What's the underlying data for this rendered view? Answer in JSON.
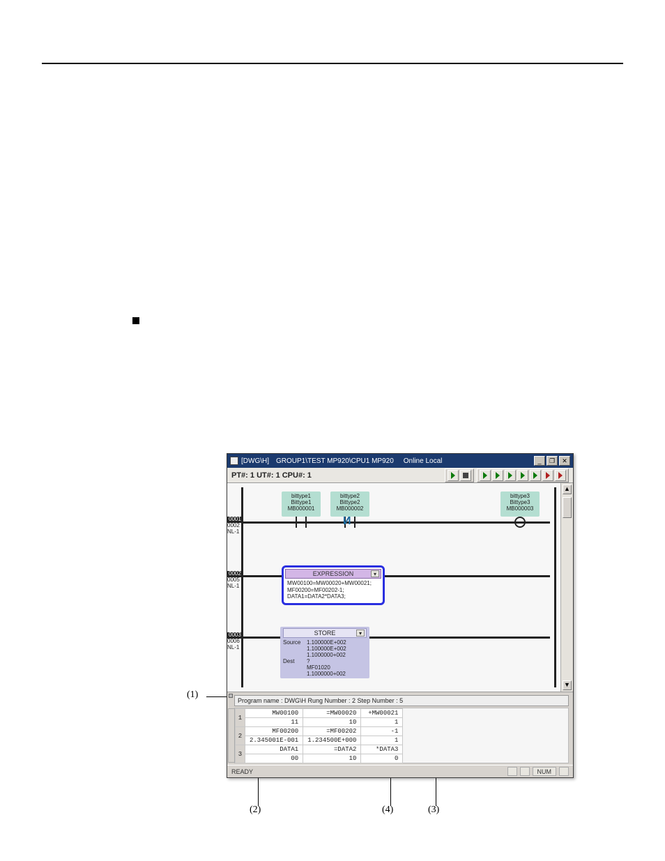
{
  "window": {
    "title_left": "[DWG\\H]",
    "title_path": "GROUP1\\TEST MP920\\CPU1 MP920",
    "title_mode": "Online Local",
    "min": "_",
    "restore": "❐",
    "close": "✕"
  },
  "subheader": {
    "text": "PT#: 1 UT#: 1 CPU#: 1"
  },
  "rungs": {
    "r1": {
      "num": "0001",
      "addr": "0002",
      "nl": "NL-1"
    },
    "r2": {
      "num": "0002",
      "addr": "0005",
      "nl": "NL-1"
    },
    "r3": {
      "num": "0003",
      "addr": "0006",
      "nl": "NL-1"
    }
  },
  "blocks": {
    "b1": {
      "l1": "bittype1",
      "l2": "Bittype1",
      "l3": "MB000001"
    },
    "b2": {
      "l1": "bittype2",
      "l2": "Bittype2",
      "l3": "MB000002"
    },
    "b3": {
      "l1": "bittype3",
      "l2": "Bittype3",
      "l3": "MB000003"
    }
  },
  "expression": {
    "title": "EXPRESSION",
    "line1": "MW00100=MW00020+MW00021;",
    "line2": "MF00200=MF00202-1;",
    "line3": "DATA1=DATA2*DATA3;"
  },
  "store": {
    "title": "STORE",
    "src_lbl": "Source",
    "src1": "1.100000E+002",
    "src2": "1.100000E+002",
    "src3": "1.1000000+002",
    "dst_lbl": "Dest",
    "dst1": "?",
    "dst2": "MF01020",
    "dst3": "1.1000000+002"
  },
  "panel": {
    "header": "Program name : DWG\\H Rung Number : 2 Step Number : 5"
  },
  "grid": {
    "r1": {
      "idx": "1",
      "c1": "MW00100",
      "c2": "=MW00020",
      "c3": "+MW00021"
    },
    "r1b": {
      "c1": "11",
      "c2": "10",
      "c3": "1"
    },
    "r2": {
      "idx": "2",
      "c1": "MF00200",
      "c2": "=MF00202",
      "c3": "-1"
    },
    "r2b": {
      "c1": "2.345001E-001",
      "c2": "1.234500E+000",
      "c3": "1"
    },
    "r3": {
      "idx": "3",
      "c1": "DATA1",
      "c2": "=DATA2",
      "c3": "*DATA3"
    },
    "r3b": {
      "c1": "00",
      "c2": "10",
      "c3": "0"
    }
  },
  "status": {
    "ready": "READY",
    "num": "NUM"
  },
  "callouts": {
    "c1": "(1)",
    "c2": "(2)",
    "c3": "(3)",
    "c4": "(4)"
  }
}
